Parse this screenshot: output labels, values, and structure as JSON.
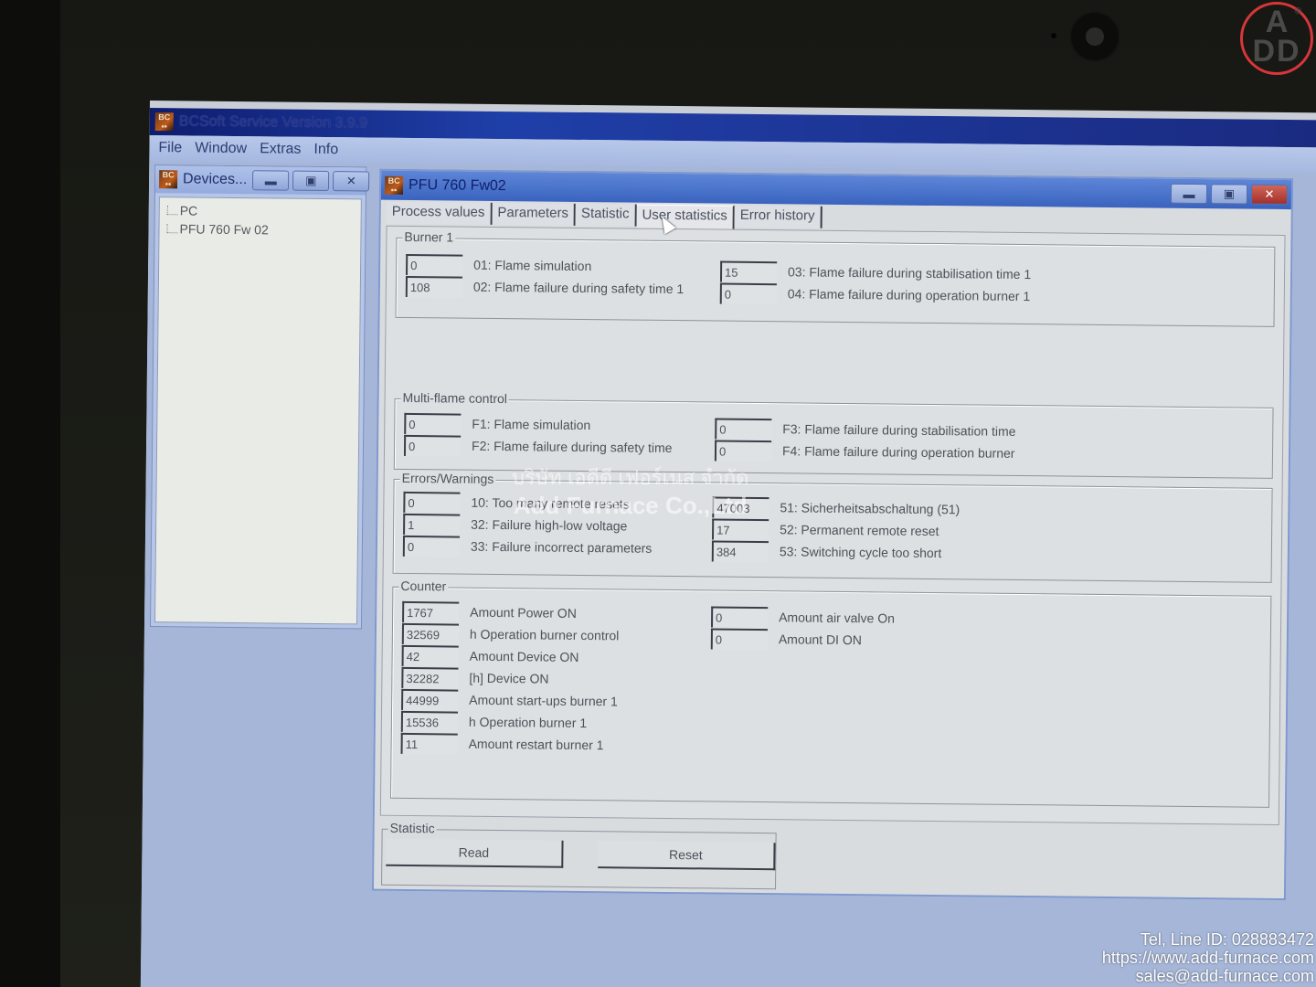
{
  "app": {
    "title": "BCSoft Service Version 3.9.9",
    "menu": [
      "File",
      "Window",
      "Extras",
      "Info"
    ]
  },
  "devices_window": {
    "title": "Devices...",
    "tree": [
      "PC",
      "PFU 760 Fw 02"
    ]
  },
  "pfu_window": {
    "title": "PFU 760 Fw02",
    "tabs": [
      {
        "label": "Process values",
        "active": false
      },
      {
        "label": "Parameters",
        "active": false
      },
      {
        "label": "Statistic",
        "active": false
      },
      {
        "label": "User statistics",
        "active": true
      },
      {
        "label": "Error history",
        "active": false
      }
    ],
    "groups": {
      "burner1": {
        "label": "Burner 1",
        "left": [
          {
            "value": "0",
            "label": "01: Flame simulation"
          },
          {
            "value": "108",
            "label": "02: Flame failure during safety time 1"
          }
        ],
        "right": [
          {
            "value": "15",
            "label": "03: Flame failure during stabilisation time 1"
          },
          {
            "value": "0",
            "label": "04: Flame failure during operation burner 1"
          }
        ]
      },
      "multiflame": {
        "label": "Multi-flame control",
        "left": [
          {
            "value": "0",
            "label": "F1: Flame simulation"
          },
          {
            "value": "0",
            "label": "F2: Flame failure during safety time"
          }
        ],
        "right": [
          {
            "value": "0",
            "label": "F3: Flame failure during stabilisation time"
          },
          {
            "value": "0",
            "label": "F4: Flame failure during operation burner"
          }
        ]
      },
      "errors": {
        "label": "Errors/Warnings",
        "left": [
          {
            "value": "0",
            "label": "10: Too many remote resets"
          },
          {
            "value": "1",
            "label": "32: Failure high-low voltage"
          },
          {
            "value": "0",
            "label": "33: Failure incorrect parameters"
          }
        ],
        "right": [
          {
            "value": "47003",
            "label": "51: Sicherheitsabschaltung (51)"
          },
          {
            "value": "17",
            "label": "52: Permanent remote reset"
          },
          {
            "value": "384",
            "label": "53: Switching cycle too short"
          }
        ]
      },
      "counter": {
        "label": "Counter",
        "left": [
          {
            "value": "1767",
            "label": "Amount Power ON"
          },
          {
            "value": "32569",
            "label": "h Operation burner control"
          },
          {
            "value": "42",
            "label": "Amount Device ON"
          },
          {
            "value": "32282",
            "label": "[h] Device ON"
          },
          {
            "value": "44999",
            "label": "Amount start-ups burner 1"
          },
          {
            "value": "15536",
            "label": "h Operation burner 1"
          },
          {
            "value": "11",
            "label": "Amount restart burner 1"
          }
        ],
        "right": [
          {
            "value": "0",
            "label": "Amount air valve On"
          },
          {
            "value": "0",
            "label": "Amount DI ON"
          }
        ]
      }
    },
    "statistic": {
      "label": "Statistic",
      "read_button": "Read",
      "reset_button": "Reset"
    }
  },
  "overlay": {
    "watermark_thai": "บริษัท เอดีดี เฟอร์เนส จำกัด",
    "watermark_en": "Add Furnace Co.,Ltd",
    "logo": {
      "top": "A",
      "bottom": "DD",
      "mark": "®",
      "ring_color": "#d8363a"
    },
    "contact": [
      "Tel, Line ID: 028883472",
      "https://www.add-furnace.com",
      "sales@add-furnace.com"
    ]
  }
}
